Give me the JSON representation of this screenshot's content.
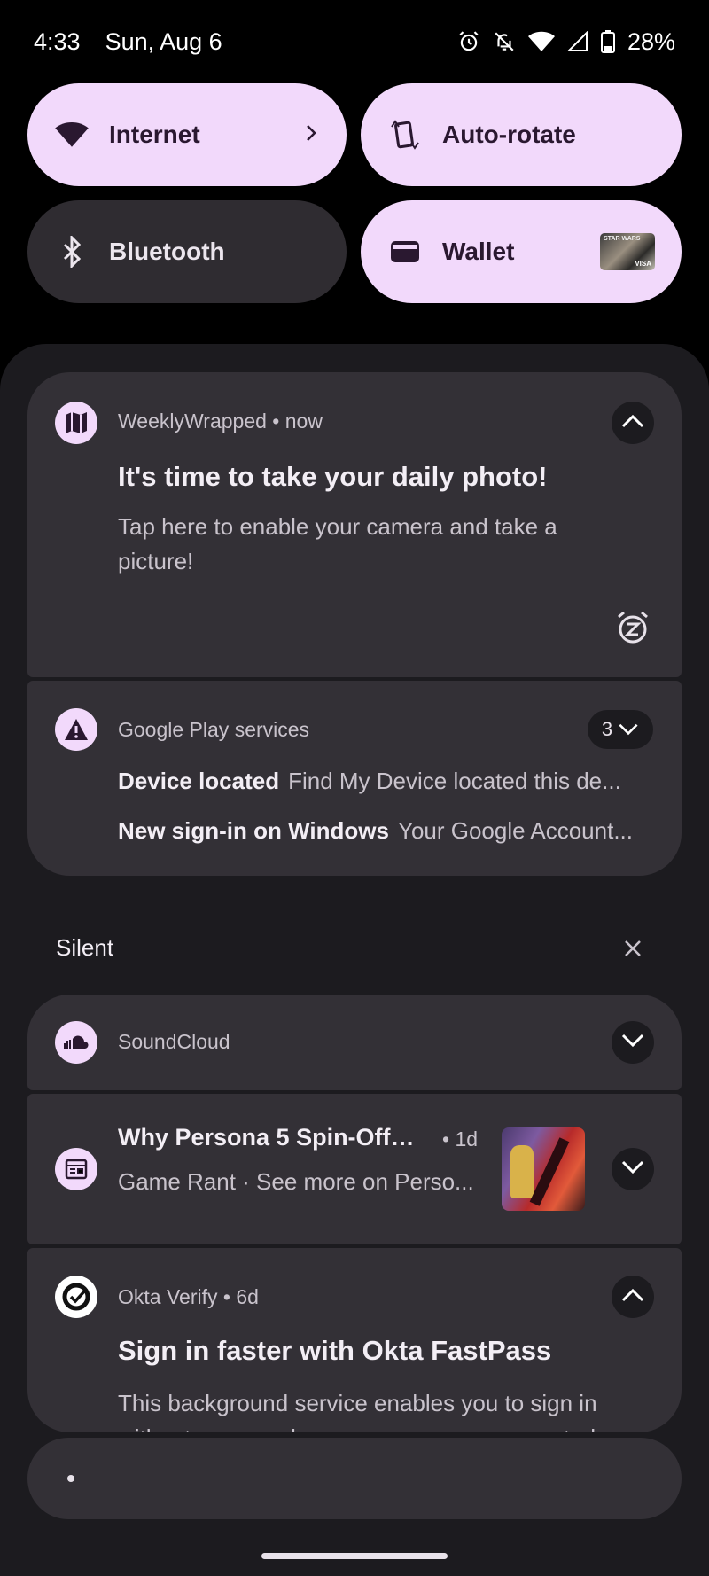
{
  "status_bar": {
    "time": "4:33",
    "date": "Sun, Aug 6",
    "battery": "28%",
    "icons": [
      "alarm-icon",
      "do-not-disturb-bell-off-icon",
      "wifi-icon",
      "cellular-signal-icon",
      "battery-icon"
    ]
  },
  "quick_tiles": {
    "internet": "Internet",
    "autorotate": "Auto-rotate",
    "bluetooth": "Bluetooth",
    "wallet": "Wallet"
  },
  "notifications": {
    "weeklywrapped": {
      "app": "WeeklyWrapped",
      "time": "now",
      "title": "It's time to take your daily photo!",
      "body": "Tap here to enable your camera and take a picture!"
    },
    "gplay": {
      "app": "Google Play services",
      "count": "3",
      "rows": [
        {
          "title": "Device located",
          "text": "Find My Device located this de..."
        },
        {
          "title": "New sign-in on Windows",
          "text": "Your Google Account..."
        }
      ]
    }
  },
  "silent": {
    "label": "Silent",
    "soundcloud": {
      "app": "SoundCloud"
    },
    "gamerant": {
      "title": "Why Persona 5 Spin-Offs...",
      "time": "1d",
      "subtitle": "Game Rant · See more on Perso..."
    },
    "okta": {
      "app": "Okta Verify",
      "time": "6d",
      "title": "Sign in faster with Okta FastPass",
      "body": "This background service enables you to sign in without passwords or usernames on supported"
    }
  },
  "colors": {
    "tile_active": "#f2d9fb",
    "tile_inactive": "#2f2c31",
    "card_bg": "#333036",
    "shade_bg": "#1c1b1f"
  }
}
